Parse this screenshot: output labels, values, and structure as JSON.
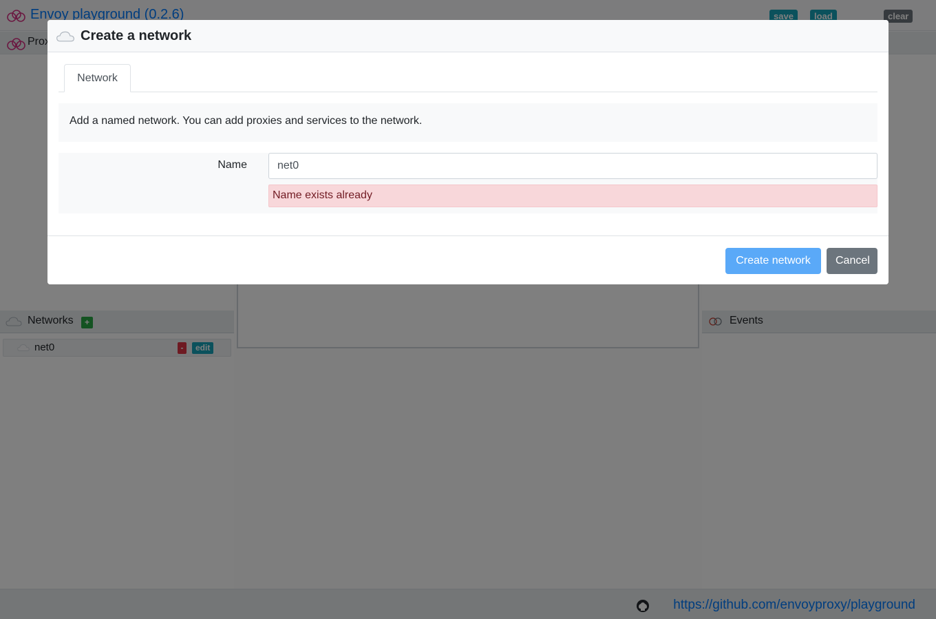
{
  "app": {
    "title": "Envoy playground (0.2.6)",
    "toolbar": {
      "save": "save",
      "load": "load",
      "clear": "clear"
    },
    "sub_title": "Prox"
  },
  "networks_panel": {
    "title": "Networks",
    "add_label": "+",
    "items": [
      {
        "name": "net0",
        "remove_label": "-",
        "edit_label": "edit"
      }
    ]
  },
  "events_panel": {
    "title": "Events"
  },
  "footer": {
    "link": "https://github.com/envoyproxy/playground"
  },
  "modal": {
    "title": "Create a network",
    "tabs": [
      {
        "label": "Network"
      }
    ],
    "description": "Add a named network. You can add proxies and services to the network.",
    "form": {
      "name_label": "Name",
      "name_value": "net0",
      "error": "Name exists already"
    },
    "buttons": {
      "submit": "Create network",
      "cancel": "Cancel"
    }
  },
  "colors": {
    "brand_link": "#007bff",
    "primary_button": "#5aa9f8",
    "secondary_button": "#6c757d",
    "error_bg": "#f8d7da",
    "error_text": "#721c24",
    "badge_info": "#17a2b8",
    "badge_add": "#28a745",
    "badge_remove": "#dc3545"
  },
  "icons": {
    "logo": "envoy-logo-icon",
    "network": "cloud-icon",
    "events": "events-icon",
    "github": "github-icon"
  }
}
